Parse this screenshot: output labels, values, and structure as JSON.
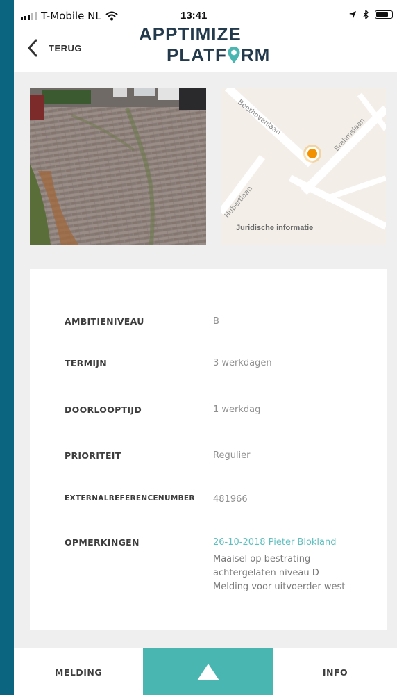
{
  "status": {
    "carrier": "T-Mobile NL",
    "time": "13:41"
  },
  "header": {
    "back_label": "TERUG",
    "logo_line1": "APPTIMIZE",
    "logo_line2_a": "PLATF",
    "logo_line2_b": "RM"
  },
  "map": {
    "legal_link": "Juridische informatie",
    "streets": [
      "Beethovenlaan",
      "Brahmslaan",
      "Hubertlaan"
    ],
    "marker_color": "#f39200"
  },
  "details": [
    {
      "label": "AMBITIENIVEAU",
      "value": "B"
    },
    {
      "label": "TERMIJN",
      "value": "3 werkdagen"
    },
    {
      "label": "DOORLOOPTIJD",
      "value": "1 werkdag"
    },
    {
      "label": "PRIORITEIT",
      "value": "Regulier"
    },
    {
      "label": "EXTERNALREFERENCENUMBER",
      "value": "481966"
    }
  ],
  "remarks": {
    "label": "OPMERKINGEN",
    "author_line": "26-10-2018 Pieter Blokland",
    "lines": [
      "Maaisel op bestrating",
      "achtergelaten niveau D",
      "Melding voor uitvoerder west"
    ]
  },
  "tabbar": {
    "left_label": "MELDING",
    "right_label": "INFO",
    "accent": "#49b6b2"
  },
  "colors": {
    "background": "#0c6580",
    "accent": "#49b6b2",
    "logo": "#233a4d"
  }
}
